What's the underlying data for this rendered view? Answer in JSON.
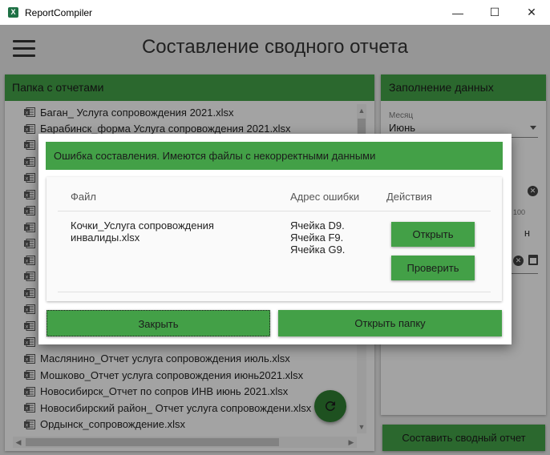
{
  "window": {
    "title": "ReportCompiler",
    "app_icon_letter": "X",
    "minimize_glyph": "—",
    "maximize_glyph": "☐",
    "close_glyph": "✕"
  },
  "header": {
    "title": "Составление сводного отчета"
  },
  "left_panel": {
    "title": "Папка с отчетами",
    "files": [
      "Баган_ Услуга сопровождения 2021.xlsx",
      "Барабинск_форма Услуга сопровождения 2021.xlsx",
      "",
      "",
      "",
      "",
      "",
      "",
      "",
      "",
      "",
      "",
      "",
      "",
      "",
      "Маслянино_Отчет услуга сопровождения июль.xlsx",
      "Мошково_Отчет услуга сопровождения июнь2021.xlsx",
      "Новосибирск_Отчет по сопров ИНВ июнь 2021.xlsx",
      "Новосибирский район_ Отчет услуга сопровождени.xlsx",
      "Ордынск_сопровождение.xlsx"
    ]
  },
  "right_panel": {
    "title": "Заполнение данных",
    "month_label": "Месяц",
    "month_value": "Июнь",
    "counter_hint": "100",
    "fragment_text": "н"
  },
  "compose_button": "Составить сводный отчет",
  "dialog": {
    "title": "Ошибка составления. Имеются файлы с некорректными данными",
    "columns": {
      "file": "Файл",
      "address": "Адрес ошибки",
      "actions": "Действия"
    },
    "rows": [
      {
        "file": "Кочки_Услуга сопровождения инвалиды.xlsx",
        "cells": [
          "Ячейка D9.",
          "Ячейка F9.",
          "Ячейка G9."
        ],
        "open_label": "Открыть",
        "check_label": "Проверить"
      }
    ],
    "close_label": "Закрыть",
    "open_folder_label": "Открыть папку"
  },
  "colors": {
    "accent_green": "#43a047",
    "dark_green": "#2e7d32",
    "excel_green": "#1e7145"
  },
  "icons": {
    "menu": "hamburger-menu-icon",
    "file": "excel-file-icon",
    "refresh": "refresh-icon",
    "clear": "clear-icon",
    "calendar": "calendar-icon",
    "dropdown": "chevron-down-icon"
  }
}
